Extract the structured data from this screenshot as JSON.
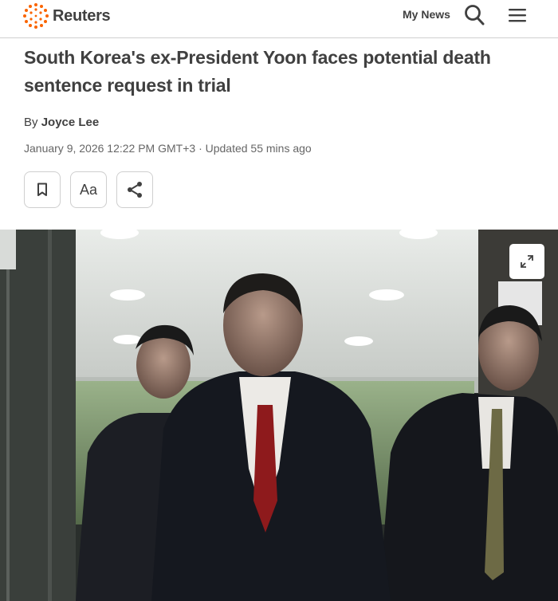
{
  "header": {
    "brand": "Reuters",
    "my_news_label": "My News",
    "brand_color": "#fa6400"
  },
  "icons": {
    "logo": "reuters-dot-logo",
    "search": "search-icon",
    "menu": "hamburger-menu-icon",
    "bookmark": "bookmark-icon",
    "share": "share-icon",
    "expand": "expand-icon"
  },
  "article": {
    "headline": "South Korea's ex-President Yoon faces potential death sentence request in trial",
    "byline_prefix": "By",
    "author": "Joyce Lee",
    "dateline": "January 9, 2026 12:22 PM GMT+3 · Updated 55 mins ago",
    "text_size_label": "Aa"
  }
}
